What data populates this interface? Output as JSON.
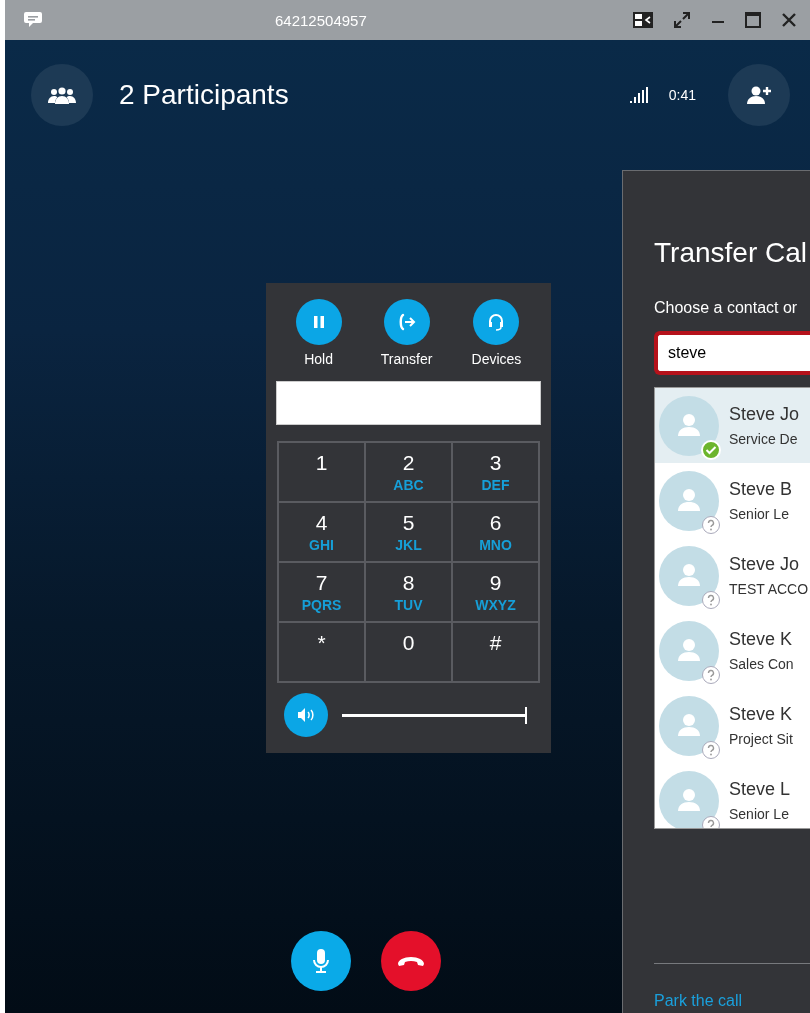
{
  "window": {
    "title": "64212504957"
  },
  "header": {
    "participants": "2 Participants",
    "call_time": "0:41"
  },
  "call_controls": [
    {
      "label": "Hold",
      "kind": "hold"
    },
    {
      "label": "Transfer",
      "kind": "transfer"
    },
    {
      "label": "Devices",
      "kind": "devices"
    }
  ],
  "dialpad": {
    "keys": [
      {
        "digit": "1"
      },
      {
        "digit": "2",
        "letters": "ABC"
      },
      {
        "digit": "3",
        "letters": "DEF"
      },
      {
        "digit": "4",
        "letters": "GHI"
      },
      {
        "digit": "5",
        "letters": "JKL"
      },
      {
        "digit": "6",
        "letters": "MNO"
      },
      {
        "digit": "7",
        "letters": "PQRS"
      },
      {
        "digit": "8",
        "letters": "TUV"
      },
      {
        "digit": "9",
        "letters": "WXYZ"
      },
      {
        "digit": "*"
      },
      {
        "digit": "0"
      },
      {
        "digit": "#"
      }
    ],
    "volume": {
      "level": 1.0
    }
  },
  "transfer_dialog": {
    "title": "Transfer Cal",
    "prompt": "Choose a contact or",
    "search": {
      "value": "steve"
    },
    "contacts": [
      {
        "name": "Steve Jo",
        "subtitle": "Service De",
        "available": true,
        "selected": true
      },
      {
        "name": "Steve B",
        "subtitle": "Senior Le",
        "available": false,
        "selected": false
      },
      {
        "name": "Steve Jo",
        "subtitle": "TEST ACCO",
        "available": false,
        "selected": false
      },
      {
        "name": "Steve K",
        "subtitle": "Sales Con",
        "available": false,
        "selected": false
      },
      {
        "name": "Steve K",
        "subtitle": "Project Sit",
        "available": false,
        "selected": false
      },
      {
        "name": "Steve L",
        "subtitle": "Senior Le",
        "available": false,
        "selected": false
      }
    ],
    "park_link": "Park the call"
  }
}
